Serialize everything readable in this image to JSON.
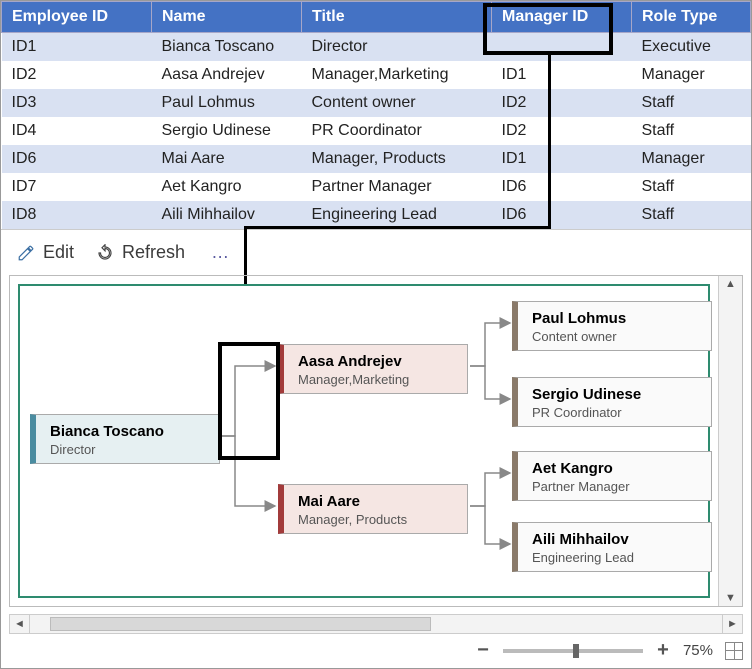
{
  "table": {
    "headers": {
      "c0": "Employee ID",
      "c1": "Name",
      "c2": "Title",
      "c3": "Manager ID",
      "c4": "Role Type"
    },
    "rows": [
      {
        "c0": "ID1",
        "c1": "Bianca Toscano",
        "c2": "Director",
        "c3": "",
        "c4": "Executive"
      },
      {
        "c0": "ID2",
        "c1": "Aasa Andrejev",
        "c2": "Manager,Marketing",
        "c3": "ID1",
        "c4": "Manager"
      },
      {
        "c0": "ID3",
        "c1": "Paul Lohmus",
        "c2": "Content owner",
        "c3": "ID2",
        "c4": "Staff"
      },
      {
        "c0": "ID4",
        "c1": "Sergio Udinese",
        "c2": "PR Coordinator",
        "c3": "ID2",
        "c4": "Staff"
      },
      {
        "c0": "ID6",
        "c1": "Mai Aare",
        "c2": "Manager, Products",
        "c3": "ID1",
        "c4": "Manager"
      },
      {
        "c0": "ID7",
        "c1": "Aet Kangro",
        "c2": "Partner Manager",
        "c3": "ID6",
        "c4": "Staff"
      },
      {
        "c0": "ID8",
        "c1": "Aili Mihhailov",
        "c2": "Engineering Lead",
        "c3": "ID6",
        "c4": "Staff"
      }
    ]
  },
  "toolbar": {
    "edit": "Edit",
    "refresh": "Refresh",
    "more": "…"
  },
  "org": {
    "root": {
      "name": "Bianca Toscano",
      "title": "Director"
    },
    "mgr1": {
      "name": "Aasa Andrejev",
      "title": "Manager,Marketing"
    },
    "mgr2": {
      "name": "Mai Aare",
      "title": "Manager, Products"
    },
    "leaf1": {
      "name": "Paul Lohmus",
      "title": "Content owner"
    },
    "leaf2": {
      "name": "Sergio Udinese",
      "title": "PR Coordinator"
    },
    "leaf3": {
      "name": "Aet Kangro",
      "title": "Partner Manager"
    },
    "leaf4": {
      "name": "Aili Mihhailov",
      "title": "Engineering Lead"
    }
  },
  "zoom": {
    "value": "75%"
  }
}
